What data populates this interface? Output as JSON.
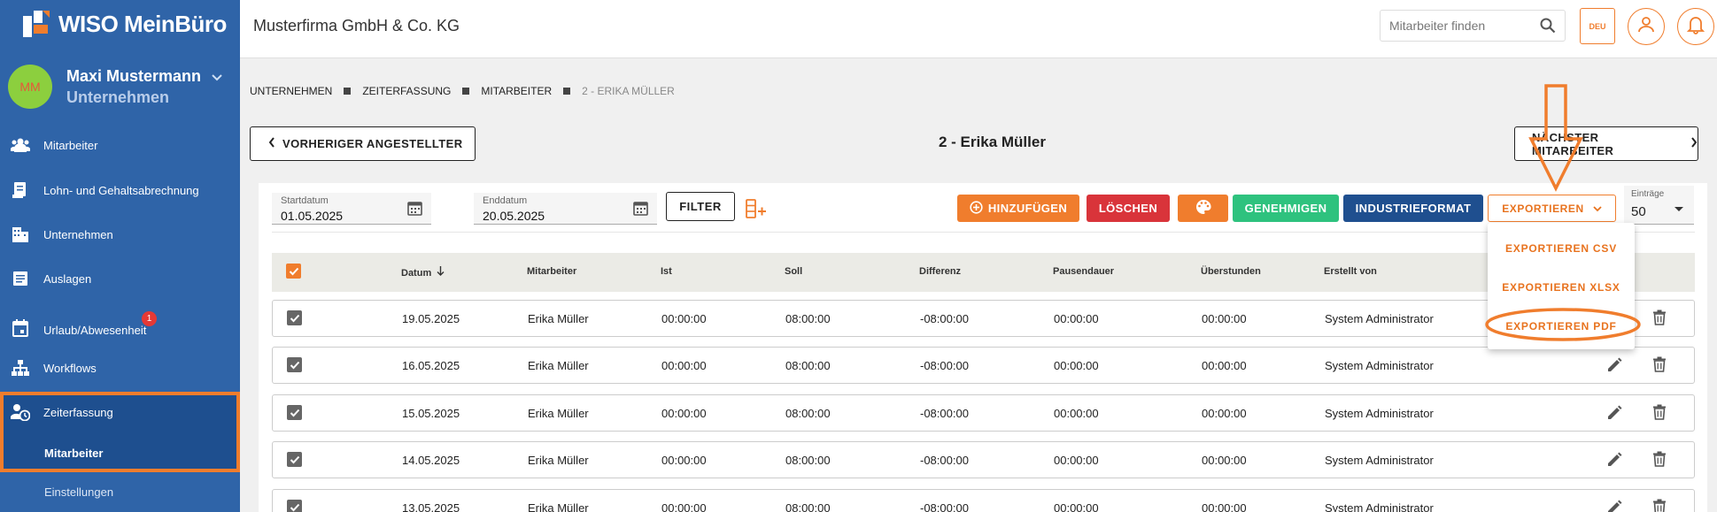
{
  "app": {
    "logo_text": "WISO MeinBüro"
  },
  "user": {
    "initials": "MM",
    "name": "Maxi Mustermann",
    "role": "Unternehmen"
  },
  "sidebar": {
    "items": [
      {
        "label": "Mitarbeiter",
        "icon": "people-icon"
      },
      {
        "label": "Lohn- und Gehaltsabrechnung",
        "icon": "payroll-icon"
      },
      {
        "label": "Unternehmen",
        "icon": "building-icon"
      },
      {
        "label": "Auslagen",
        "icon": "receipt-icon"
      },
      {
        "label": "Urlaub/Abwesenheit",
        "icon": "calendar-icon",
        "badge": "1"
      },
      {
        "label": "Workflows",
        "icon": "workflow-icon"
      },
      {
        "label": "Zeiterfassung",
        "icon": "time-tracking-icon"
      }
    ],
    "sub_items": [
      {
        "label": "Mitarbeiter"
      },
      {
        "label": "Einstellungen"
      }
    ]
  },
  "header": {
    "company": "Musterfirma GmbH & Co. KG",
    "search_placeholder": "Mitarbeiter finden",
    "language": "DEU"
  },
  "breadcrumb": [
    "UNTERNEHMEN",
    "ZEITERFASSUNG",
    "MITARBEITER",
    "2 - ERIKA MÜLLER"
  ],
  "navigation": {
    "prev_label": "VORHERIGER ANGESTELLTER",
    "next_label": "NÄCHSTER MITARBEITER",
    "employee_title": "2 - Erika Müller"
  },
  "filters": {
    "start_label": "Startdatum",
    "start_value": "01.05.2025",
    "end_label": "Enddatum",
    "end_value": "20.05.2025",
    "filter_label": "FILTER",
    "entries_label": "Einträge",
    "entries_value": "50"
  },
  "toolbar": {
    "add_label": "HINZUFÜGEN",
    "delete_label": "LÖSCHEN",
    "approve_label": "GENEHMIGEN",
    "industry_label": "INDUSTRIEFORMAT",
    "export_label": "EXPORTIEREN",
    "colors": {
      "orange": "#f07d2d",
      "red": "#d9343a",
      "green": "#2ec27e",
      "blue": "#1f4f8f"
    }
  },
  "export_menu": [
    "EXPORTIEREN CSV",
    "EXPORTIEREN XLSX",
    "EXPORTIEREN PDF"
  ],
  "table": {
    "columns": [
      "Datum",
      "Mitarbeiter",
      "Ist",
      "Soll",
      "Differenz",
      "Pausendauer",
      "Überstunden",
      "Erstellt von"
    ],
    "rows": [
      [
        "19.05.2025",
        "Erika Müller",
        "00:00:00",
        "08:00:00",
        "-08:00:00",
        "00:00:00",
        "00:00:00",
        "System Administrator"
      ],
      [
        "16.05.2025",
        "Erika Müller",
        "00:00:00",
        "08:00:00",
        "-08:00:00",
        "00:00:00",
        "00:00:00",
        "System Administrator"
      ],
      [
        "15.05.2025",
        "Erika Müller",
        "00:00:00",
        "08:00:00",
        "-08:00:00",
        "00:00:00",
        "00:00:00",
        "System Administrator"
      ],
      [
        "14.05.2025",
        "Erika Müller",
        "00:00:00",
        "08:00:00",
        "-08:00:00",
        "00:00:00",
        "00:00:00",
        "System Administrator"
      ],
      [
        "13.05.2025",
        "Erika Müller",
        "00:00:00",
        "08:00:00",
        "-08:00:00",
        "00:00:00",
        "00:00:00",
        "System Administrator"
      ]
    ]
  }
}
